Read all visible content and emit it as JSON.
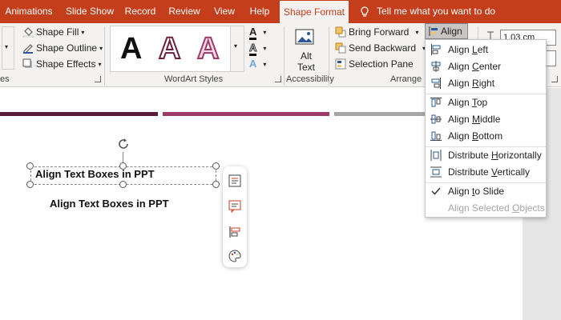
{
  "tabs": [
    {
      "label": "Animations"
    },
    {
      "label": "Slide Show"
    },
    {
      "label": "Record"
    },
    {
      "label": "Review"
    },
    {
      "label": "View"
    },
    {
      "label": "Help"
    },
    {
      "label": "Shape Format",
      "active": true
    }
  ],
  "tell_me": "Tell me what you want to do",
  "ribbon": {
    "shape_fill": "Shape Fill",
    "shape_outline": "Shape Outline",
    "shape_effects": "Shape Effects",
    "wordart_letter": "A",
    "wordart_label": "WordArt Styles",
    "alt_text_line1": "Alt",
    "alt_text_line2": "Text",
    "accessibility_label": "Accessibility",
    "bring_forward": "Bring Forward",
    "send_backward": "Send Backward",
    "selection_pane": "Selection Pane",
    "arrange_label": "Arrange",
    "align": "Align",
    "size_value": "1.03 cm",
    "truncated_group_label": "es"
  },
  "slide": {
    "textbox_text": "Align Text Boxes in PPT",
    "textbox2_text": "Align Text Boxes in PPT"
  },
  "align_menu": {
    "items": [
      {
        "pre": "Align ",
        "u": "L",
        "post": "eft",
        "icon": "align-left-icon"
      },
      {
        "pre": "Align ",
        "u": "C",
        "post": "enter",
        "icon": "align-center-icon"
      },
      {
        "pre": "Align ",
        "u": "R",
        "post": "ight",
        "icon": "align-right-icon"
      },
      {
        "pre": "Align ",
        "u": "T",
        "post": "op",
        "icon": "align-top-icon"
      },
      {
        "pre": "Align ",
        "u": "M",
        "post": "iddle",
        "icon": "align-middle-icon"
      },
      {
        "pre": "Align ",
        "u": "B",
        "post": "ottom",
        "icon": "align-bottom-icon"
      },
      {
        "pre": "Distribute ",
        "u": "H",
        "post": "orizontally",
        "icon": "distribute-horizontal-icon"
      },
      {
        "pre": "Distribute ",
        "u": "V",
        "post": "ertically",
        "icon": "distribute-vertical-icon"
      },
      {
        "pre": "Align ",
        "u": "t",
        "post": "o Slide",
        "icon": "check-icon",
        "checked": true
      },
      {
        "pre": "Align Selected ",
        "u": "O",
        "post": "bjects",
        "icon": "",
        "disabled": true
      }
    ]
  },
  "colors": {
    "accent": "#c43e1c",
    "band1": "#5c1a3a",
    "band2": "#9e3a6a",
    "band3": "#a6a6a6",
    "wordart_dark": "#6b1f3c"
  }
}
